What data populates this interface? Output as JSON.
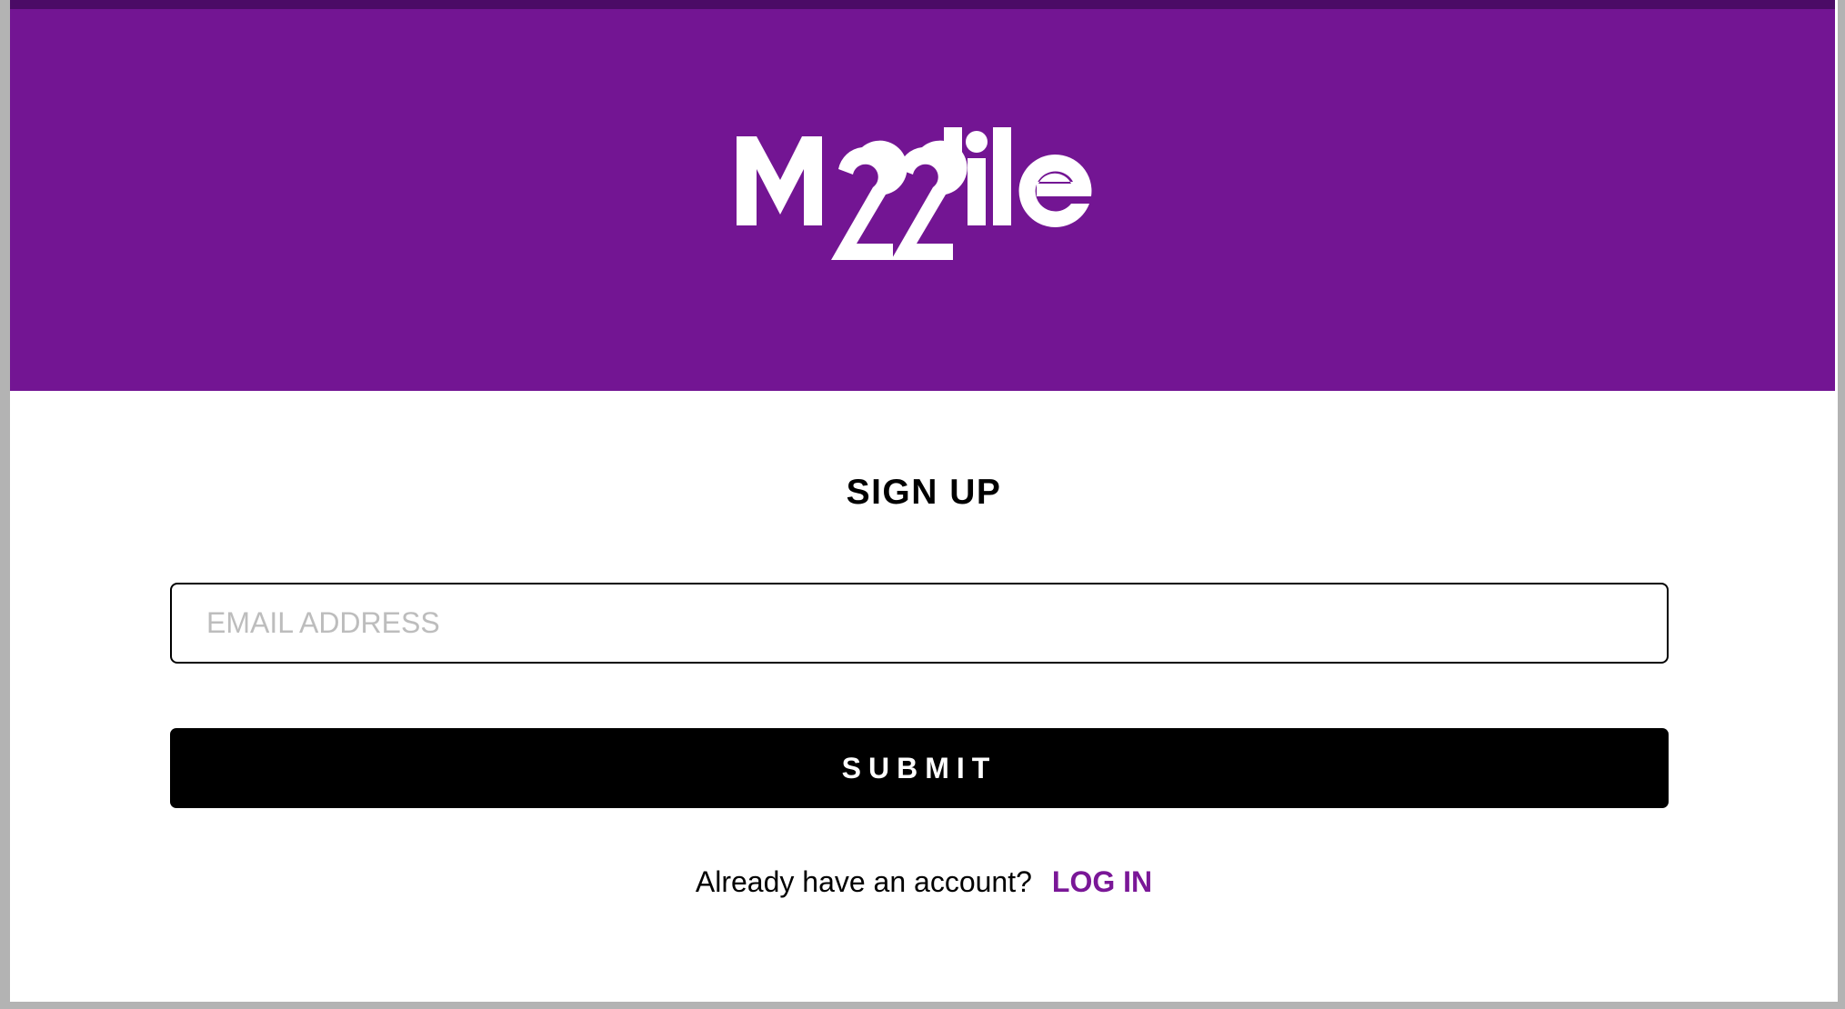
{
  "brand": {
    "logo_text": "Mobile22",
    "header_color": "#731593",
    "accent_color": "#7a1797"
  },
  "form": {
    "title": "SIGN UP",
    "email": {
      "placeholder": "EMAIL ADDRESS",
      "value": ""
    },
    "submit_label": "SUBMIT"
  },
  "footer": {
    "prompt": "Already have an account?",
    "login_label": "LOG IN"
  }
}
